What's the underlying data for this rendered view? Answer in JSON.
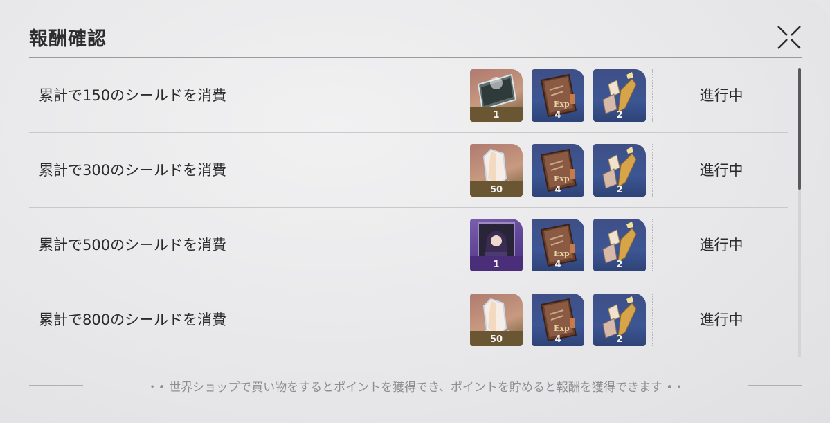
{
  "dialog": {
    "title": "報酬確認",
    "close_icon": "close-x-icon"
  },
  "rows": [
    {
      "label": "累計で150のシールドを消費",
      "status": "進行中",
      "rewards": [
        {
          "icon": "ticket-card-icon",
          "quantity": "1",
          "rarity_color": "#c79a80"
        },
        {
          "icon": "exp-book-icon",
          "quantity": "4",
          "rarity_color": "#3c5694"
        },
        {
          "icon": "material-crystal-icon",
          "quantity": "2",
          "rarity_color": "#3c5694"
        }
      ]
    },
    {
      "label": "累計で300のシールドを消費",
      "status": "進行中",
      "rewards": [
        {
          "icon": "prism-crystal-icon",
          "quantity": "50",
          "rarity_color": "#c79a80"
        },
        {
          "icon": "exp-book-icon",
          "quantity": "4",
          "rarity_color": "#3c5694"
        },
        {
          "icon": "material-crystal-icon",
          "quantity": "2",
          "rarity_color": "#3c5694"
        }
      ]
    },
    {
      "label": "累計で500のシールドを消費",
      "status": "進行中",
      "rewards": [
        {
          "icon": "character-portrait-card-icon",
          "quantity": "1",
          "rarity_color": "#5b3f92"
        },
        {
          "icon": "exp-book-icon",
          "quantity": "4",
          "rarity_color": "#3c5694"
        },
        {
          "icon": "material-crystal-icon",
          "quantity": "2",
          "rarity_color": "#3c5694"
        }
      ]
    },
    {
      "label": "累計で800のシールドを消費",
      "status": "進行中",
      "rewards": [
        {
          "icon": "prism-crystal-icon",
          "quantity": "50",
          "rarity_color": "#c79a80"
        },
        {
          "icon": "exp-book-icon",
          "quantity": "4",
          "rarity_color": "#3c5694"
        },
        {
          "icon": "material-crystal-icon",
          "quantity": "2",
          "rarity_color": "#3c5694"
        }
      ]
    }
  ],
  "footer": {
    "note": "・• 世界ショップで買い物をするとポイントを獲得でき、ポイントを貯めると報酬を獲得できます •・"
  }
}
